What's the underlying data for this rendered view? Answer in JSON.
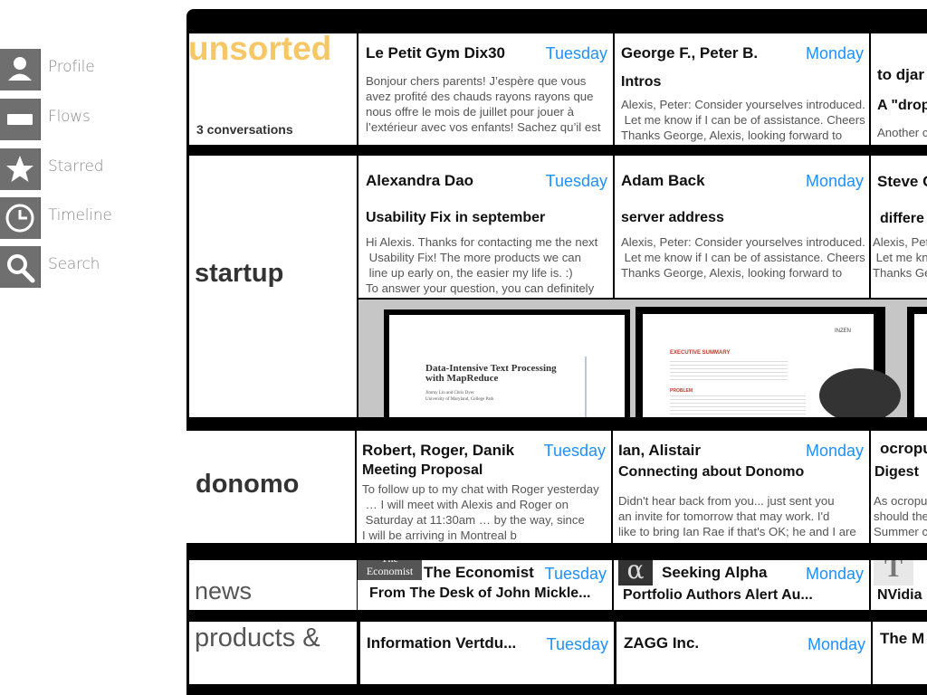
{
  "sidebar": {
    "items": [
      {
        "label": "Profile",
        "icon": "person-icon"
      },
      {
        "label": "Flows",
        "icon": "flows-icon"
      },
      {
        "label": "Starred",
        "icon": "star-icon"
      },
      {
        "label": "Timeline",
        "icon": "clock-icon"
      },
      {
        "label": "Search",
        "icon": "search-icon"
      }
    ]
  },
  "colors": {
    "accent": "#1e90ff",
    "unsorted": "#f7c766",
    "nav_tile": "#6f6f6f"
  },
  "groups": {
    "unsorted": {
      "name": "unsorted",
      "count": "3 conversations",
      "cells": [
        {
          "sender": "Le Petit Gym Dix30",
          "day": "Tuesday",
          "preview": "Bonjour chers parents! J’espère que vous\navez profité des chauds rayons rayons que\nnous offre le mois de juillet pour jouer à\nl’extérieur avec vos enfants! Sachez qu’il est"
        },
        {
          "sender": "George F., Peter B.",
          "day": "Monday",
          "subject": "Intros",
          "preview": "Alexis, Peter: Consider yourselves introduced.\n Let me know if I can be of assistance. Cheers\nThanks George, Alexis, looking forward to"
        },
        {
          "sender": "to djar",
          "subject": "A \"drop",
          "preview": "Another c"
        }
      ]
    },
    "startup": {
      "name": "startup",
      "cells": [
        {
          "sender": "Alexandra Dao",
          "day": "Tuesday",
          "subject": "Usability Fix in september",
          "preview": "Hi Alexis. Thanks for contacting me the next\n Usability Fix! The more products we can\n line up early on, the easier my life is. :)\nTo answer your question, you can definitely"
        },
        {
          "sender": "Adam Back",
          "day": "Monday",
          "subject": "server address",
          "preview": "Alexis, Peter: Consider yourselves introduced.\n Let me know if I can be of assistance. Cheers\nThanks George, Alexis, looking forward to"
        },
        {
          "sender": "Steve C",
          "subject": "differe",
          "preview": "Alexis, Pet\n Let me kn\nThanks Ge"
        }
      ],
      "docs": [
        {
          "title": "Data-Intensive Text Processing\nwith MapReduce",
          "authors": "Jimmy Lin and Chris Dyer",
          "affiliation": "University of Maryland, College Park"
        },
        {
          "heading": "EXECUTIVE SUMMARY",
          "subheading": "PROBLEM",
          "brand": "INZEN"
        }
      ]
    },
    "donomo": {
      "name": "donomo",
      "cells": [
        {
          "sender": "Robert, Roger, Danik",
          "day": "Tuesday",
          "subject": "Meeting Proposal",
          "preview": "To follow up to my chat with Roger yesterday\n … I will meet with Alexis and Roger on\n Saturday at 11:30am … by the way, since\nI will be arriving in Montreal b"
        },
        {
          "sender": "Ian, Alistair",
          "day": "Monday",
          "subject": "Connecting about Donomo",
          "preview": "Didn't hear back from you... just sent you\nan invite for tomorrow that may work. I'd\nlike to bring Ian Rae if that's OK; he and I are"
        },
        {
          "sender": "ocropu",
          "subject": "Digest",
          "preview": "As ocropu\nshould the\nSummer c"
        }
      ]
    },
    "news": {
      "name": "news",
      "cells": [
        {
          "sender": "The Economist",
          "day": "Tuesday",
          "subject": "From The Desk of John Mickle...",
          "logo_text": "The Economist"
        },
        {
          "sender": "Seeking Alpha",
          "day": "Monday",
          "subject": "Portfolio Authors Alert Au...",
          "logo_text": "α"
        },
        {
          "sender": "T",
          "subject": "NVidia",
          "logo_text": "T"
        }
      ]
    },
    "products": {
      "name": "products &",
      "cells": [
        {
          "sender": "Information Vertdu...",
          "day": "Tuesday"
        },
        {
          "sender": "ZAGG Inc.",
          "day": "Monday"
        },
        {
          "sender": "The M"
        }
      ]
    }
  }
}
